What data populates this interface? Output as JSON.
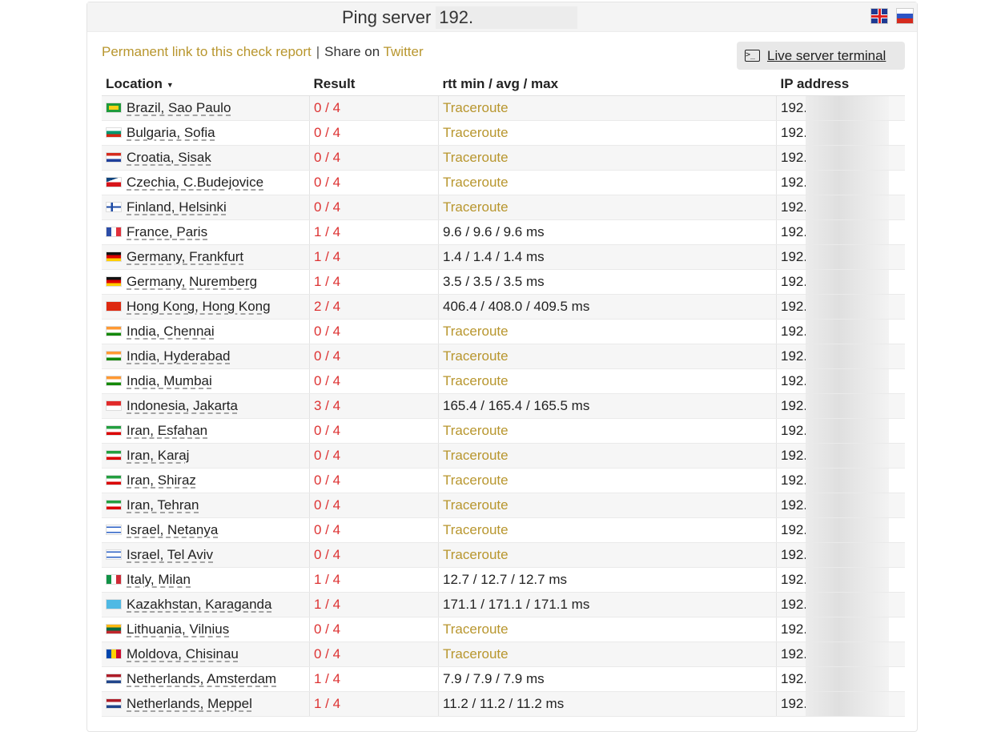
{
  "header": {
    "title": "Ping server",
    "host_prefix": "192.",
    "lang_icons": [
      "uk-flag-icon",
      "ru-flag-icon"
    ]
  },
  "links": {
    "permalink": "Permanent link to this check report",
    "separator": "|",
    "share_text": "Share on",
    "twitter": "Twitter"
  },
  "terminal_button": {
    "label": "Live server terminal",
    "icon": "terminal-icon"
  },
  "table": {
    "columns": [
      "Location",
      "Result",
      "rtt min / avg / max",
      "IP address"
    ],
    "rows": [
      {
        "location": "Brazil, Sao Paulo",
        "result": "0 / 4",
        "rtt": "Traceroute",
        "ip": "192."
      },
      {
        "location": "Bulgaria, Sofia",
        "result": "0 / 4",
        "rtt": "Traceroute",
        "ip": "192."
      },
      {
        "location": "Croatia, Sisak",
        "result": "0 / 4",
        "rtt": "Traceroute",
        "ip": "192."
      },
      {
        "location": "Czechia, C.Budejovice",
        "result": "0 / 4",
        "rtt": "Traceroute",
        "ip": "192."
      },
      {
        "location": "Finland, Helsinki",
        "result": "0 / 4",
        "rtt": "Traceroute",
        "ip": "192."
      },
      {
        "location": "France, Paris",
        "result": "1 / 4",
        "rtt": "9.6 / 9.6 / 9.6 ms",
        "ip": "192."
      },
      {
        "location": "Germany, Frankfurt",
        "result": "1 / 4",
        "rtt": "1.4 / 1.4 / 1.4 ms",
        "ip": "192."
      },
      {
        "location": "Germany, Nuremberg",
        "result": "1 / 4",
        "rtt": "3.5 / 3.5 / 3.5 ms",
        "ip": "192."
      },
      {
        "location": "Hong Kong, Hong Kong",
        "result": "2 / 4",
        "rtt": "406.4 / 408.0 / 409.5 ms",
        "ip": "192."
      },
      {
        "location": "India, Chennai",
        "result": "0 / 4",
        "rtt": "Traceroute",
        "ip": "192."
      },
      {
        "location": "India, Hyderabad",
        "result": "0 / 4",
        "rtt": "Traceroute",
        "ip": "192."
      },
      {
        "location": "India, Mumbai",
        "result": "0 / 4",
        "rtt": "Traceroute",
        "ip": "192."
      },
      {
        "location": "Indonesia, Jakarta",
        "result": "3 / 4",
        "rtt": "165.4 / 165.4 / 165.5 ms",
        "ip": "192."
      },
      {
        "location": "Iran, Esfahan",
        "result": "0 / 4",
        "rtt": "Traceroute",
        "ip": "192."
      },
      {
        "location": "Iran, Karaj",
        "result": "0 / 4",
        "rtt": "Traceroute",
        "ip": "192."
      },
      {
        "location": "Iran, Shiraz",
        "result": "0 / 4",
        "rtt": "Traceroute",
        "ip": "192."
      },
      {
        "location": "Iran, Tehran",
        "result": "0 / 4",
        "rtt": "Traceroute",
        "ip": "192."
      },
      {
        "location": "Israel, Netanya",
        "result": "0 / 4",
        "rtt": "Traceroute",
        "ip": "192."
      },
      {
        "location": "Israel, Tel Aviv",
        "result": "0 / 4",
        "rtt": "Traceroute",
        "ip": "192."
      },
      {
        "location": "Italy, Milan",
        "result": "1 / 4",
        "rtt": "12.7 / 12.7 / 12.7 ms",
        "ip": "192."
      },
      {
        "location": "Kazakhstan, Karaganda",
        "result": "1 / 4",
        "rtt": "171.1 / 171.1 / 171.1 ms",
        "ip": "192."
      },
      {
        "location": "Lithuania, Vilnius",
        "result": "0 / 4",
        "rtt": "Traceroute",
        "ip": "192."
      },
      {
        "location": "Moldova, Chisinau",
        "result": "0 / 4",
        "rtt": "Traceroute",
        "ip": "192."
      },
      {
        "location": "Netherlands, Amsterdam",
        "result": "1 / 4",
        "rtt": "7.9 / 7.9 / 7.9 ms",
        "ip": "192."
      },
      {
        "location": "Netherlands, Meppel",
        "result": "1 / 4",
        "rtt": "11.2 / 11.2 / 11.2 ms",
        "ip": "192."
      }
    ]
  },
  "colors": {
    "link_gold": "#b8962e",
    "result_red": "#dd3333"
  }
}
